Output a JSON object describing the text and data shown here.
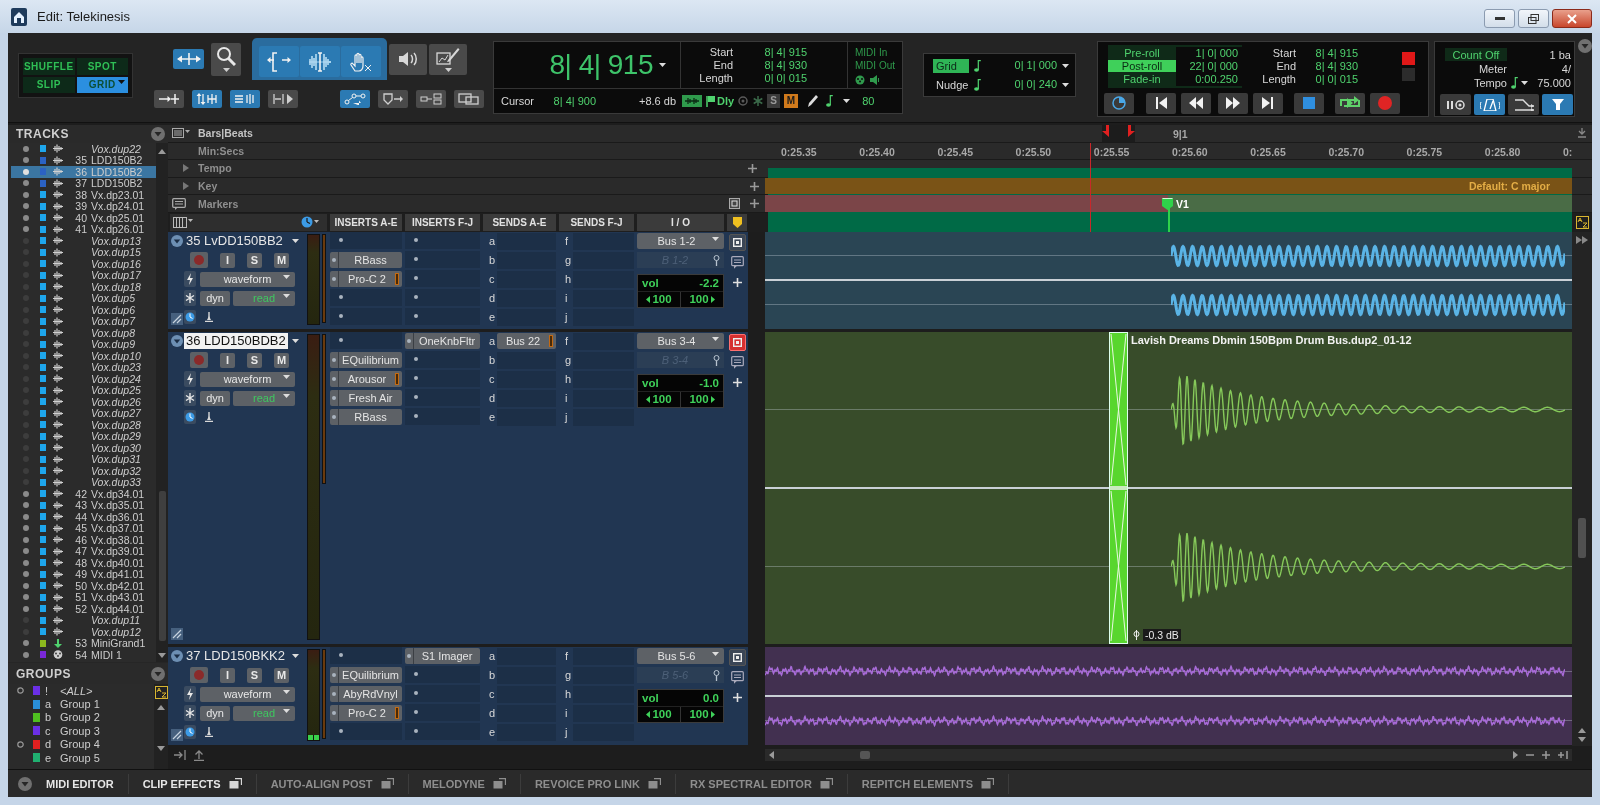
{
  "window": {
    "title": "Edit: Telekinesis"
  },
  "edit_modes": [
    {
      "label": "SHUFFLE",
      "selected": false
    },
    {
      "label": "SPOT",
      "selected": false
    },
    {
      "label": "SLIP",
      "selected": false
    },
    {
      "label": "GRID",
      "selected": true
    }
  ],
  "tools": [
    {
      "selected": true
    },
    {
      "selected": false
    },
    {
      "selected": true
    },
    {
      "selected": true
    },
    {
      "selected": true
    },
    {
      "selected": false
    },
    {
      "selected": false
    }
  ],
  "tool_options": [
    {
      "selected": false
    },
    {
      "selected": true
    },
    {
      "selected": true
    },
    {
      "selected": false
    },
    {
      "selected": true
    },
    {
      "selected": false
    },
    {
      "selected": false
    },
    {
      "selected": false
    }
  ],
  "counter": {
    "main": "8| 4| 915",
    "selection": [
      {
        "label": "Start",
        "value": "8| 4| 915"
      },
      {
        "label": "End",
        "value": "8| 4| 930"
      },
      {
        "label": "Length",
        "value": "0| 0| 015"
      }
    ],
    "midi": [
      "MIDI In",
      "MIDI Out"
    ],
    "cursor_label": "Cursor",
    "cursor": "8| 4| 900",
    "readout": "+8.6 db",
    "delay": "Dly",
    "s": "S",
    "m": "M",
    "velocity": "80"
  },
  "grid": [
    {
      "label": "Grid",
      "value": "0| 1| 000",
      "on": true
    },
    {
      "label": "Nudge",
      "value": "0| 0| 240",
      "on": false
    }
  ],
  "transport": {
    "rolls": [
      {
        "label": "Pre-roll",
        "value": "1| 0| 000",
        "on": false
      },
      {
        "label": "Post-roll",
        "value": "22| 0| 000",
        "on": true
      },
      {
        "label": "Fade-in",
        "value": "0:00.250",
        "on": false
      }
    ],
    "selection": [
      {
        "label": "Start",
        "value": "8| 4| 915"
      },
      {
        "label": "End",
        "value": "8| 4| 930"
      },
      {
        "label": "Length",
        "value": "0| 0| 015"
      }
    ]
  },
  "tempo_panel": {
    "rows": [
      {
        "kind": "toggle",
        "label": "Count Off",
        "value": "1 ba",
        "on": false
      },
      {
        "kind": "plain",
        "label": "Meter",
        "value": "4/"
      },
      {
        "kind": "tempo",
        "label": "Tempo",
        "value": "75.000"
      }
    ],
    "toggles": [
      {
        "selected": false
      },
      {
        "selected": true
      },
      {
        "selected": false
      },
      {
        "selected": true
      }
    ]
  },
  "rulers": [
    {
      "kind": "bars",
      "label": "Bars|Beats",
      "ticks": [
        "9|1"
      ]
    },
    {
      "kind": "time",
      "label": "Min:Secs",
      "ticks": [
        "0:25.35",
        "0:25.40",
        "0:25.45",
        "0:25.50",
        "0:25.55",
        "0:25.60",
        "0:25.65",
        "0:25.70",
        "0:25.75",
        "0:25.80",
        "0:"
      ]
    },
    {
      "kind": "tempo",
      "label": "Tempo",
      "expanded": false
    },
    {
      "kind": "key",
      "label": "Key",
      "expanded": false,
      "value": "Default: C major"
    },
    {
      "kind": "markers",
      "label": "Markers",
      "markers": [
        {
          "label": "V1"
        }
      ]
    }
  ],
  "columns": [
    "INSERTS A-E",
    "INSERTS F-J",
    "SENDS A-E",
    "SENDS F-J",
    "I / O"
  ],
  "tracks": [
    {
      "name": "35 LvDD150BB2",
      "selected": false,
      "buttons": [
        "I",
        "S",
        "M"
      ],
      "view": "waveform",
      "automation_mode": "dyn",
      "automation": "read",
      "inserts_ae": [
        {
          "kind": "empty"
        },
        {
          "kind": "plugin",
          "name": "RBass",
          "gr_meter": false
        },
        {
          "kind": "plugin",
          "name": "Pro-C 2",
          "gr_meter": true
        },
        {
          "kind": "empty"
        },
        {
          "kind": "empty"
        }
      ],
      "inserts_fj": [
        {
          "kind": "empty"
        },
        {
          "kind": "empty"
        },
        {
          "kind": "empty"
        },
        {
          "kind": "empty"
        },
        {
          "kind": "empty"
        }
      ],
      "sends_ae": [
        {
          "letter": "a",
          "kind": "empty"
        },
        {
          "letter": "b",
          "kind": "empty"
        },
        {
          "letter": "c",
          "kind": "empty"
        },
        {
          "letter": "d",
          "kind": "empty"
        },
        {
          "letter": "e",
          "kind": "empty"
        }
      ],
      "sends_fj": [
        {
          "letter": "f",
          "kind": "empty"
        },
        {
          "letter": "g",
          "kind": "empty"
        },
        {
          "letter": "h",
          "kind": "empty"
        },
        {
          "letter": "i",
          "kind": "empty"
        },
        {
          "letter": "j",
          "kind": "empty"
        }
      ],
      "io": {
        "output": "Bus 1-2",
        "input": "B 1-2",
        "output_window": false,
        "volume_label": "vol",
        "volume": "-2.2",
        "pan": [
          "100",
          "100"
        ]
      },
      "clip": {
        "kind": "pulses",
        "color": "#5ab4e6"
      }
    },
    {
      "name": "36 LDD150BDB2",
      "selected": true,
      "buttons": [
        "I",
        "S",
        "M"
      ],
      "view": "waveform",
      "automation_mode": "dyn",
      "automation": "read",
      "inserts_ae": [
        {
          "kind": "empty"
        },
        {
          "kind": "plugin",
          "name": "EQuilibrium",
          "gr_meter": false
        },
        {
          "kind": "plugin",
          "name": "Arousor",
          "gr_meter": true
        },
        {
          "kind": "plugin",
          "name": "Fresh Air",
          "gr_meter": false
        },
        {
          "kind": "plugin",
          "name": "RBass",
          "gr_meter": false
        }
      ],
      "inserts_fj": [
        {
          "kind": "plugin",
          "name": "OneKnbFltr",
          "gr_meter": false
        },
        {
          "kind": "empty"
        },
        {
          "kind": "empty"
        },
        {
          "kind": "empty"
        },
        {
          "kind": "empty"
        }
      ],
      "sends_ae": [
        {
          "letter": "a",
          "kind": "send",
          "name": "Bus 22",
          "gr_meter": true
        },
        {
          "letter": "b",
          "kind": "empty"
        },
        {
          "letter": "c",
          "kind": "empty"
        },
        {
          "letter": "d",
          "kind": "empty"
        },
        {
          "letter": "e",
          "kind": "empty"
        }
      ],
      "sends_fj": [
        {
          "letter": "f",
          "kind": "empty"
        },
        {
          "letter": "g",
          "kind": "empty"
        },
        {
          "letter": "h",
          "kind": "empty"
        },
        {
          "letter": "i",
          "kind": "empty"
        },
        {
          "letter": "j",
          "kind": "empty"
        }
      ],
      "io": {
        "output": "Bus 3-4",
        "input": "B 3-4",
        "output_window": true,
        "volume_label": "vol",
        "volume": "-1.0",
        "pan": [
          "100",
          "100"
        ]
      },
      "clip": {
        "kind": "drum",
        "color": "#86c95a",
        "name": "Lavish Dreams Dbmin 150Bpm Drum Bus.dup2_01-12",
        "gain": "-0.3 dB",
        "fade_selected": true
      }
    },
    {
      "name": "37 LDD150BKK2",
      "selected": false,
      "buttons": [
        "I",
        "S",
        "M"
      ],
      "view": "waveform",
      "automation_mode": "dyn",
      "automation": "read",
      "meter": {
        "level": 0.05
      },
      "inserts_ae": [
        {
          "kind": "empty"
        },
        {
          "kind": "plugin",
          "name": "EQuilibrium",
          "gr_meter": false
        },
        {
          "kind": "plugin",
          "name": "AbyRdVnyl",
          "gr_meter": false
        },
        {
          "kind": "plugin",
          "name": "Pro-C 2",
          "gr_meter": true
        },
        {
          "kind": "empty"
        }
      ],
      "inserts_fj": [
        {
          "kind": "plugin",
          "name": "S1 Imager",
          "gr_meter": false
        },
        {
          "kind": "empty"
        },
        {
          "kind": "empty"
        },
        {
          "kind": "empty"
        },
        {
          "kind": "empty"
        }
      ],
      "sends_ae": [
        {
          "letter": "a",
          "kind": "empty"
        },
        {
          "letter": "b",
          "kind": "empty"
        },
        {
          "letter": "c",
          "kind": "empty"
        },
        {
          "letter": "d",
          "kind": "empty"
        },
        {
          "letter": "e",
          "kind": "empty"
        }
      ],
      "sends_fj": [
        {
          "letter": "f",
          "kind": "empty"
        },
        {
          "letter": "g",
          "kind": "empty"
        },
        {
          "letter": "h",
          "kind": "empty"
        },
        {
          "letter": "i",
          "kind": "empty"
        },
        {
          "letter": "j",
          "kind": "empty"
        }
      ],
      "io": {
        "output": "Bus 5-6",
        "input": "B 5-6",
        "output_window": false,
        "volume_label": "vol",
        "volume": "0.0",
        "pan": [
          "100",
          "100"
        ]
      },
      "clip": {
        "kind": "noise",
        "color": "#a86bd8"
      }
    }
  ],
  "tracks_panel": {
    "title": "TRACKS",
    "items": [
      {
        "name": "Vox.dup22",
        "shown": true,
        "inactive": true,
        "selected": false,
        "color": "#1ea6ec",
        "kind": "audio"
      },
      {
        "number": "35",
        "name": "LDD150B2",
        "shown": true,
        "inactive": false,
        "selected": false,
        "color": "#2b62c4",
        "kind": "audio"
      },
      {
        "number": "36",
        "name": "LDD150B2",
        "shown": true,
        "inactive": false,
        "selected": true,
        "color": "#2b62c4",
        "kind": "audio"
      },
      {
        "number": "37",
        "name": "LDD150B2",
        "shown": true,
        "inactive": false,
        "selected": false,
        "color": "#2b62c4",
        "kind": "audio"
      },
      {
        "number": "38",
        "name": "Vx.dp23.01",
        "shown": true,
        "inactive": false,
        "selected": false,
        "color": "#1ea6ec",
        "kind": "audio"
      },
      {
        "number": "39",
        "name": "Vx.dp24.01",
        "shown": true,
        "inactive": false,
        "selected": false,
        "color": "#1ea6ec",
        "kind": "audio"
      },
      {
        "number": "40",
        "name": "Vx.dp25.01",
        "shown": true,
        "inactive": false,
        "selected": false,
        "color": "#1ea6ec",
        "kind": "audio"
      },
      {
        "number": "41",
        "name": "Vx.dp26.01",
        "shown": true,
        "inactive": false,
        "selected": false,
        "color": "#1ea6ec",
        "kind": "audio"
      },
      {
        "name": "Vox.dup13",
        "shown": false,
        "inactive": true,
        "selected": false,
        "color": "#1ea6ec",
        "kind": "audio"
      },
      {
        "name": "Vox.dup15",
        "shown": false,
        "inactive": true,
        "selected": false,
        "color": "#1ea6ec",
        "kind": "audio"
      },
      {
        "name": "Vox.dup16",
        "shown": false,
        "inactive": true,
        "selected": false,
        "color": "#1ea6ec",
        "kind": "audio"
      },
      {
        "name": "Vox.dup17",
        "shown": false,
        "inactive": true,
        "selected": false,
        "color": "#1ea6ec",
        "kind": "audio"
      },
      {
        "name": "Vox.dup18",
        "shown": false,
        "inactive": true,
        "selected": false,
        "color": "#1ea6ec",
        "kind": "audio"
      },
      {
        "name": "Vox.dup5",
        "shown": false,
        "inactive": true,
        "selected": false,
        "color": "#1ea6ec",
        "kind": "audio"
      },
      {
        "name": "Vox.dup6",
        "shown": false,
        "inactive": true,
        "selected": false,
        "color": "#1ea6ec",
        "kind": "audio"
      },
      {
        "name": "Vox.dup7",
        "shown": false,
        "inactive": true,
        "selected": false,
        "color": "#1ea6ec",
        "kind": "audio"
      },
      {
        "name": "Vox.dup8",
        "shown": false,
        "inactive": true,
        "selected": false,
        "color": "#1ea6ec",
        "kind": "audio"
      },
      {
        "name": "Vox.dup9",
        "shown": false,
        "inactive": true,
        "selected": false,
        "color": "#1ea6ec",
        "kind": "audio"
      },
      {
        "name": "Vox.dup10",
        "shown": false,
        "inactive": true,
        "selected": false,
        "color": "#1ea6ec",
        "kind": "audio"
      },
      {
        "name": "Vox.dup23",
        "shown": false,
        "inactive": true,
        "selected": false,
        "color": "#1ea6ec",
        "kind": "audio"
      },
      {
        "name": "Vox.dup24",
        "shown": false,
        "inactive": true,
        "selected": false,
        "color": "#1ea6ec",
        "kind": "audio"
      },
      {
        "name": "Vox.dup25",
        "shown": false,
        "inactive": true,
        "selected": false,
        "color": "#1ea6ec",
        "kind": "audio"
      },
      {
        "name": "Vox.dup26",
        "shown": false,
        "inactive": true,
        "selected": false,
        "color": "#1ea6ec",
        "kind": "audio"
      },
      {
        "name": "Vox.dup27",
        "shown": false,
        "inactive": true,
        "selected": false,
        "color": "#1ea6ec",
        "kind": "audio"
      },
      {
        "name": "Vox.dup28",
        "shown": false,
        "inactive": true,
        "selected": false,
        "color": "#1ea6ec",
        "kind": "audio"
      },
      {
        "name": "Vox.dup29",
        "shown": false,
        "inactive": true,
        "selected": false,
        "color": "#1ea6ec",
        "kind": "audio"
      },
      {
        "name": "Vox.dup30",
        "shown": false,
        "inactive": true,
        "selected": false,
        "color": "#1ea6ec",
        "kind": "audio"
      },
      {
        "name": "Vox.dup31",
        "shown": false,
        "inactive": true,
        "selected": false,
        "color": "#1ea6ec",
        "kind": "audio"
      },
      {
        "name": "Vox.dup32",
        "shown": false,
        "inactive": true,
        "selected": false,
        "color": "#1ea6ec",
        "kind": "audio"
      },
      {
        "name": "Vox.dup33",
        "shown": false,
        "inactive": true,
        "selected": false,
        "color": "#1ea6ec",
        "kind": "audio"
      },
      {
        "number": "42",
        "name": "Vx.dp34.01",
        "shown": true,
        "inactive": false,
        "selected": false,
        "color": "#1ea6ec",
        "kind": "audio"
      },
      {
        "number": "43",
        "name": "Vx.dp35.01",
        "shown": true,
        "inactive": false,
        "selected": false,
        "color": "#1ea6ec",
        "kind": "audio"
      },
      {
        "number": "44",
        "name": "Vx.dp36.01",
        "shown": true,
        "inactive": false,
        "selected": false,
        "color": "#1ea6ec",
        "kind": "audio"
      },
      {
        "number": "45",
        "name": "Vx.dp37.01",
        "shown": true,
        "inactive": false,
        "selected": false,
        "color": "#1ea6ec",
        "kind": "audio"
      },
      {
        "number": "46",
        "name": "Vx.dp38.01",
        "shown": true,
        "inactive": false,
        "selected": false,
        "color": "#1ea6ec",
        "kind": "audio"
      },
      {
        "number": "47",
        "name": "Vx.dp39.01",
        "shown": true,
        "inactive": false,
        "selected": false,
        "color": "#1ea6ec",
        "kind": "audio"
      },
      {
        "number": "48",
        "name": "Vx.dp40.01",
        "shown": true,
        "inactive": false,
        "selected": false,
        "color": "#1ea6ec",
        "kind": "audio"
      },
      {
        "number": "49",
        "name": "Vx.dp41.01",
        "shown": true,
        "inactive": false,
        "selected": false,
        "color": "#1ea6ec",
        "kind": "audio"
      },
      {
        "number": "50",
        "name": "Vx.dp42.01",
        "shown": true,
        "inactive": false,
        "selected": false,
        "color": "#1ea6ec",
        "kind": "audio"
      },
      {
        "number": "51",
        "name": "Vx.dp43.01",
        "shown": true,
        "inactive": false,
        "selected": false,
        "color": "#1ea6ec",
        "kind": "audio"
      },
      {
        "number": "52",
        "name": "Vx.dp44.01",
        "shown": true,
        "inactive": false,
        "selected": false,
        "color": "#1ea6ec",
        "kind": "audio"
      },
      {
        "name": "Vox.dup11",
        "shown": false,
        "inactive": true,
        "selected": false,
        "color": "#1ea6ec",
        "kind": "audio"
      },
      {
        "name": "Vox.dup12",
        "shown": false,
        "inactive": true,
        "selected": false,
        "color": "#1ea6ec",
        "kind": "audio"
      },
      {
        "number": "53",
        "name": "MiniGrand1",
        "shown": true,
        "inactive": false,
        "selected": false,
        "color": "#8cb81e",
        "kind": "instrument"
      },
      {
        "number": "54",
        "name": "MIDI 1",
        "shown": true,
        "inactive": false,
        "selected": false,
        "color": "#7a28d8",
        "kind": "midi"
      }
    ]
  },
  "groups_panel": {
    "title": "GROUPS",
    "items": [
      {
        "kind": "all",
        "id": "!",
        "name": "<ALL>",
        "color": "#6b2fe6",
        "indicator": true
      },
      {
        "kind": "group",
        "id": "a",
        "name": "Group 1",
        "color": "#2a8fd8",
        "indicator": false
      },
      {
        "kind": "group",
        "id": "b",
        "name": "Group 2",
        "color": "#4fbf20",
        "indicator": false
      },
      {
        "kind": "group",
        "id": "c",
        "name": "Group 3",
        "color": "#6b2fe6",
        "indicator": false
      },
      {
        "kind": "group",
        "id": "d",
        "name": "Group 4",
        "color": "#e02020",
        "indicator": true
      },
      {
        "kind": "group",
        "id": "e",
        "name": "Group 5",
        "color": "#20b070",
        "indicator": false
      }
    ]
  },
  "bottom_tabs": [
    {
      "label": "MIDI EDITOR",
      "enabled": true,
      "window": false
    },
    {
      "label": "CLIP EFFECTS",
      "enabled": true,
      "window": true
    },
    {
      "label": "AUTO-ALIGN POST",
      "enabled": false,
      "window": true
    },
    {
      "label": "MELODYNE",
      "enabled": false,
      "window": true
    },
    {
      "label": "REVOICE PRO LINK",
      "enabled": false,
      "window": true
    },
    {
      "label": "RX SPECTRAL EDITOR",
      "enabled": false,
      "window": true
    },
    {
      "label": "REPITCH ELEMENTS",
      "enabled": false,
      "window": true
    }
  ]
}
